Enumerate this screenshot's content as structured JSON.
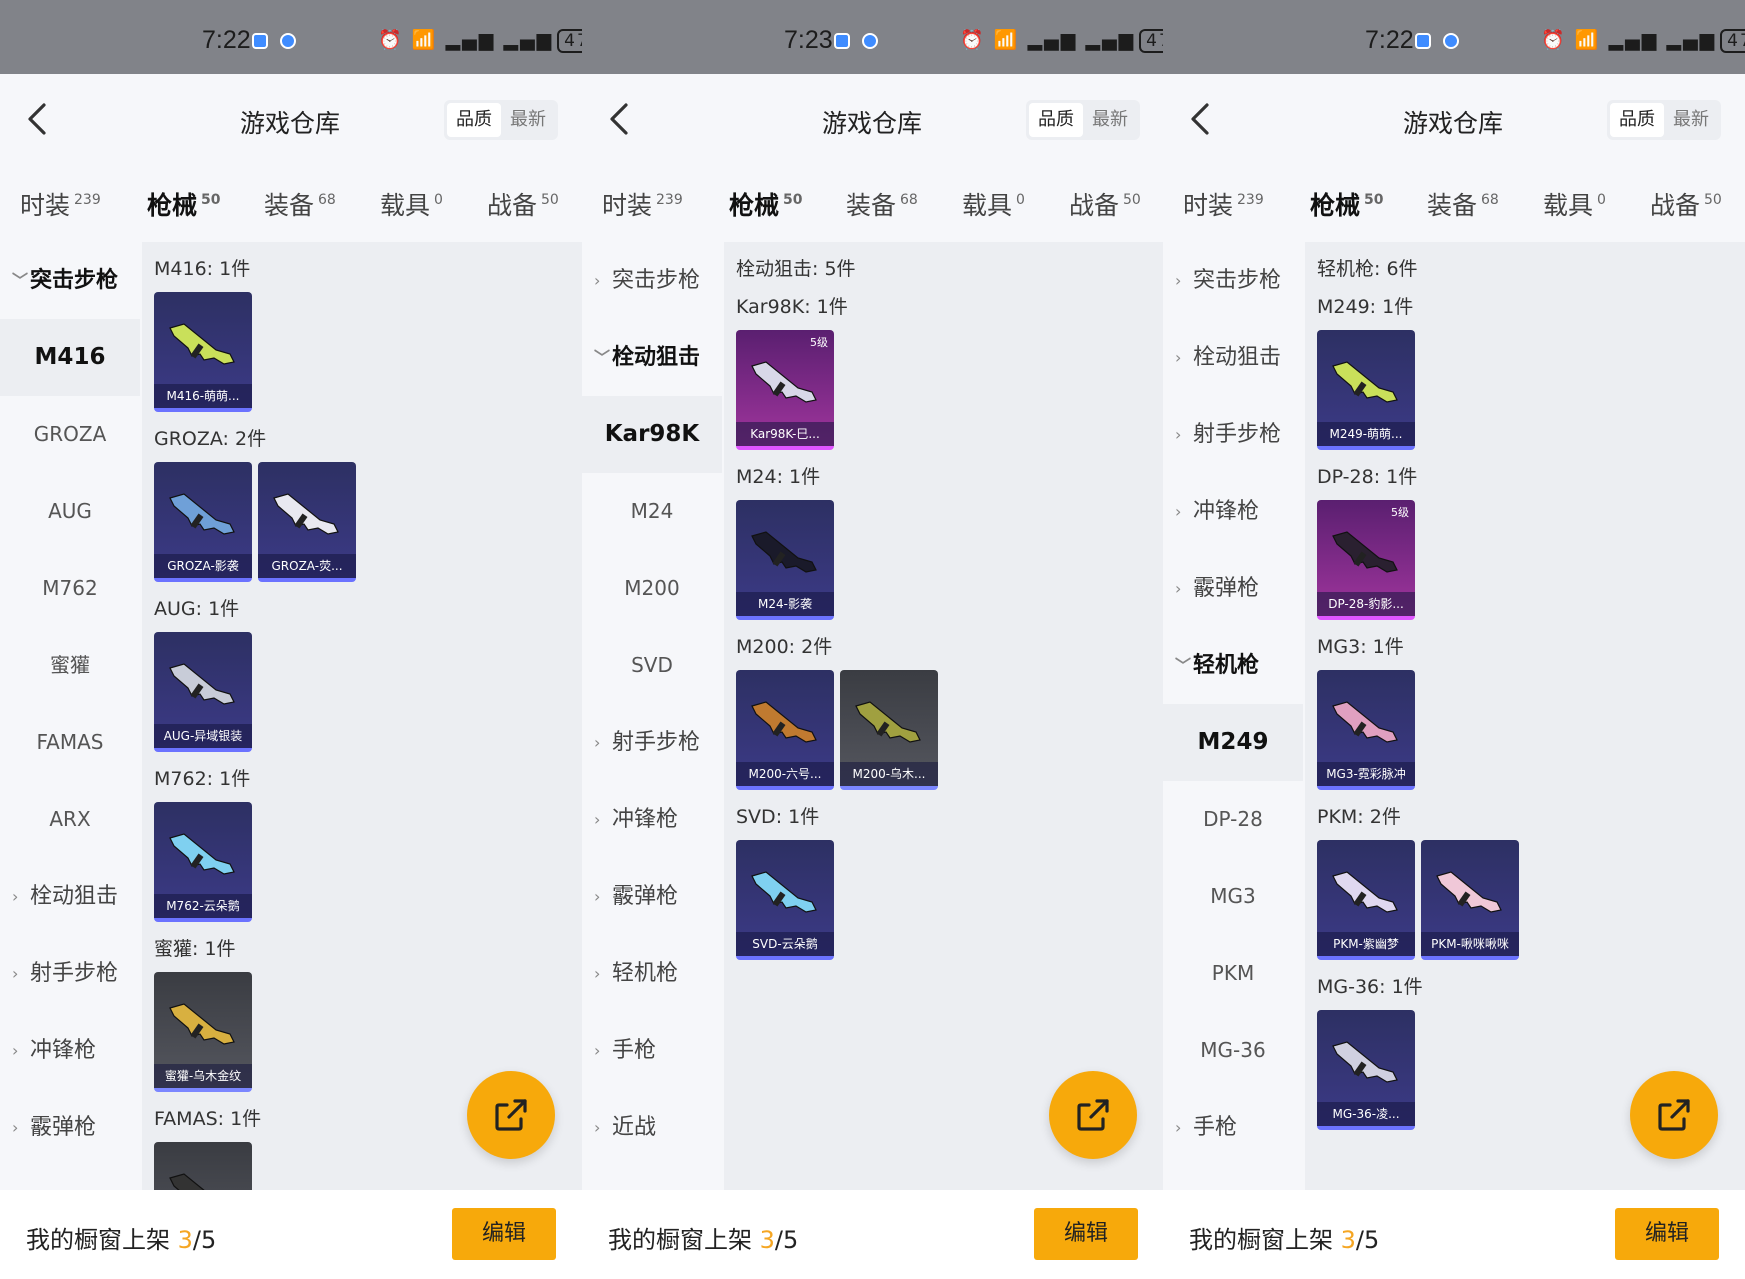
{
  "colors": {
    "accent": "#f7a90b",
    "tab_underline": "#f5a623",
    "card_blue": "#3c3a87",
    "card_pink": "#a0359d"
  },
  "panels": [
    {
      "status": {
        "time": "7:22",
        "battery": "47"
      },
      "header": {
        "title": "游戏仓库",
        "sort_quality": "品质",
        "sort_newest": "最新"
      },
      "tabs": [
        {
          "label": "时装",
          "count": "239"
        },
        {
          "label": "枪械",
          "count": "50"
        },
        {
          "label": "装备",
          "count": "68"
        },
        {
          "label": "载具",
          "count": "0"
        },
        {
          "label": "战备",
          "count": "50"
        }
      ],
      "sidebar": [
        {
          "label": "突击步枪",
          "type": "open"
        },
        {
          "label": "M416",
          "type": "sub-active"
        },
        {
          "label": "GROZA",
          "type": "sub"
        },
        {
          "label": "AUG",
          "type": "sub"
        },
        {
          "label": "M762",
          "type": "sub"
        },
        {
          "label": "蜜獾",
          "type": "sub"
        },
        {
          "label": "FAMAS",
          "type": "sub"
        },
        {
          "label": "ARX",
          "type": "sub"
        },
        {
          "label": "栓动狙击",
          "type": "closed"
        },
        {
          "label": "射手步枪",
          "type": "closed"
        },
        {
          "label": "冲锋枪",
          "type": "closed"
        },
        {
          "label": "霰弹枪",
          "type": "closed"
        }
      ],
      "content": [
        {
          "title": "M416: 1件",
          "cards": [
            {
              "name": "M416-萌萌...",
              "style": "blue",
              "tint": "#c9e05a"
            }
          ]
        },
        {
          "title": "GROZA: 2件",
          "cards": [
            {
              "name": "GROZA-影袭",
              "style": "blue",
              "tint": "#6fa0d8"
            },
            {
              "name": "GROZA-荧...",
              "style": "blue",
              "tint": "#e8e8f0"
            }
          ]
        },
        {
          "title": "AUG: 1件",
          "cards": [
            {
              "name": "AUG-异域银装",
              "style": "blue",
              "tint": "#c8ccd8"
            }
          ]
        },
        {
          "title": "M762: 1件",
          "cards": [
            {
              "name": "M762-云朵鹅",
              "style": "blue",
              "tint": "#7fd0f0"
            }
          ]
        },
        {
          "title": "蜜獾: 1件",
          "cards": [
            {
              "name": "蜜獾-乌木金纹",
              "style": "gray",
              "tint": "#d8b040"
            }
          ]
        },
        {
          "title": "FAMAS: 1件",
          "cards": [
            {
              "name": "",
              "style": "gray",
              "tint": "#333"
            }
          ]
        }
      ],
      "footer": {
        "prefix": "我的橱窗上架 ",
        "current": "3",
        "total": "/5",
        "edit": "编辑"
      }
    },
    {
      "status": {
        "time": "7:23",
        "battery": "47"
      },
      "header": {
        "title": "游戏仓库",
        "sort_quality": "品质",
        "sort_newest": "最新"
      },
      "tabs": [
        {
          "label": "时装",
          "count": "239"
        },
        {
          "label": "枪械",
          "count": "50"
        },
        {
          "label": "装备",
          "count": "68"
        },
        {
          "label": "载具",
          "count": "0"
        },
        {
          "label": "战备",
          "count": "50"
        }
      ],
      "sidebar": [
        {
          "label": "突击步枪",
          "type": "closed"
        },
        {
          "label": "栓动狙击",
          "type": "open"
        },
        {
          "label": "Kar98K",
          "type": "sub-active"
        },
        {
          "label": "M24",
          "type": "sub"
        },
        {
          "label": "M200",
          "type": "sub"
        },
        {
          "label": "SVD",
          "type": "sub"
        },
        {
          "label": "射手步枪",
          "type": "closed"
        },
        {
          "label": "冲锋枪",
          "type": "closed"
        },
        {
          "label": "霰弹枪",
          "type": "closed"
        },
        {
          "label": "轻机枪",
          "type": "closed"
        },
        {
          "label": "手枪",
          "type": "closed"
        },
        {
          "label": "近战",
          "type": "closed"
        }
      ],
      "content": [
        {
          "title": "栓动狙击: 5件",
          "cards": []
        },
        {
          "title": "Kar98K: 1件",
          "cards": [
            {
              "name": "Kar98K-巳...",
              "style": "pink",
              "tint": "#d8d8e8",
              "level": "5级"
            }
          ]
        },
        {
          "title": "M24: 1件",
          "cards": [
            {
              "name": "M24-影袭",
              "style": "blue",
              "tint": "#1a1a2a"
            }
          ]
        },
        {
          "title": "M200: 2件",
          "cards": [
            {
              "name": "M200-六号...",
              "style": "blue",
              "tint": "#c07a30"
            },
            {
              "name": "M200-乌木...",
              "style": "gray",
              "tint": "#a0a040"
            }
          ]
        },
        {
          "title": "SVD: 1件",
          "cards": [
            {
              "name": "SVD-云朵鹅",
              "style": "blue",
              "tint": "#7fd0f0"
            }
          ]
        }
      ],
      "footer": {
        "prefix": "我的橱窗上架 ",
        "current": "3",
        "total": "/5",
        "edit": "编辑"
      }
    },
    {
      "status": {
        "time": "7:22",
        "battery": "47"
      },
      "header": {
        "title": "游戏仓库",
        "sort_quality": "品质",
        "sort_newest": "最新"
      },
      "tabs": [
        {
          "label": "时装",
          "count": "239"
        },
        {
          "label": "枪械",
          "count": "50"
        },
        {
          "label": "装备",
          "count": "68"
        },
        {
          "label": "载具",
          "count": "0"
        },
        {
          "label": "战备",
          "count": "50"
        }
      ],
      "sidebar": [
        {
          "label": "突击步枪",
          "type": "closed"
        },
        {
          "label": "栓动狙击",
          "type": "closed"
        },
        {
          "label": "射手步枪",
          "type": "closed"
        },
        {
          "label": "冲锋枪",
          "type": "closed"
        },
        {
          "label": "霰弹枪",
          "type": "closed"
        },
        {
          "label": "轻机枪",
          "type": "open"
        },
        {
          "label": "M249",
          "type": "sub-active"
        },
        {
          "label": "DP-28",
          "type": "sub"
        },
        {
          "label": "MG3",
          "type": "sub"
        },
        {
          "label": "PKM",
          "type": "sub"
        },
        {
          "label": "MG-36",
          "type": "sub"
        },
        {
          "label": "手枪",
          "type": "closed"
        }
      ],
      "content": [
        {
          "title": "轻机枪: 6件",
          "cards": []
        },
        {
          "title": "M249: 1件",
          "cards": [
            {
              "name": "M249-萌萌...",
              "style": "blue",
              "tint": "#c9e05a"
            }
          ]
        },
        {
          "title": "DP-28: 1件",
          "cards": [
            {
              "name": "DP-28-豹影...",
              "style": "pink",
              "tint": "#2a2030",
              "level": "5级"
            }
          ]
        },
        {
          "title": "MG3: 1件",
          "cards": [
            {
              "name": "MG3-霓彩脉冲",
              "style": "blue",
              "tint": "#e0a0c0"
            }
          ]
        },
        {
          "title": "PKM: 2件",
          "cards": [
            {
              "name": "PKM-紫幽梦",
              "style": "blue",
              "tint": "#e0d8f0"
            },
            {
              "name": "PKM-啾咪啾咪",
              "style": "blue",
              "tint": "#f0c8d8"
            }
          ]
        },
        {
          "title": "MG-36: 1件",
          "cards": [
            {
              "name": "MG-36-凌...",
              "style": "blue",
              "tint": "#d0d0e0"
            }
          ]
        }
      ],
      "footer": {
        "prefix": "我的橱窗上架 ",
        "current": "3",
        "total": "/5",
        "edit": "编辑"
      }
    }
  ]
}
